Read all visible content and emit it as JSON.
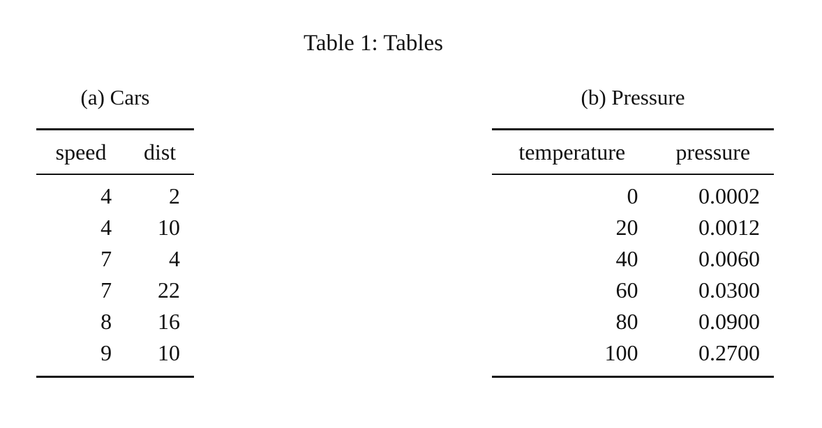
{
  "title": "Table 1: Tables",
  "tables": [
    {
      "caption": "(a) Cars",
      "columns": [
        "speed",
        "dist"
      ],
      "rows": [
        [
          "4",
          "2"
        ],
        [
          "4",
          "10"
        ],
        [
          "7",
          "4"
        ],
        [
          "7",
          "22"
        ],
        [
          "8",
          "16"
        ],
        [
          "9",
          "10"
        ]
      ]
    },
    {
      "caption": "(b) Pressure",
      "columns": [
        "temperature",
        "pressure"
      ],
      "rows": [
        [
          "0",
          "0.0002"
        ],
        [
          "20",
          "0.0012"
        ],
        [
          "40",
          "0.0060"
        ],
        [
          "60",
          "0.0300"
        ],
        [
          "80",
          "0.0900"
        ],
        [
          "100",
          "0.2700"
        ]
      ]
    }
  ]
}
